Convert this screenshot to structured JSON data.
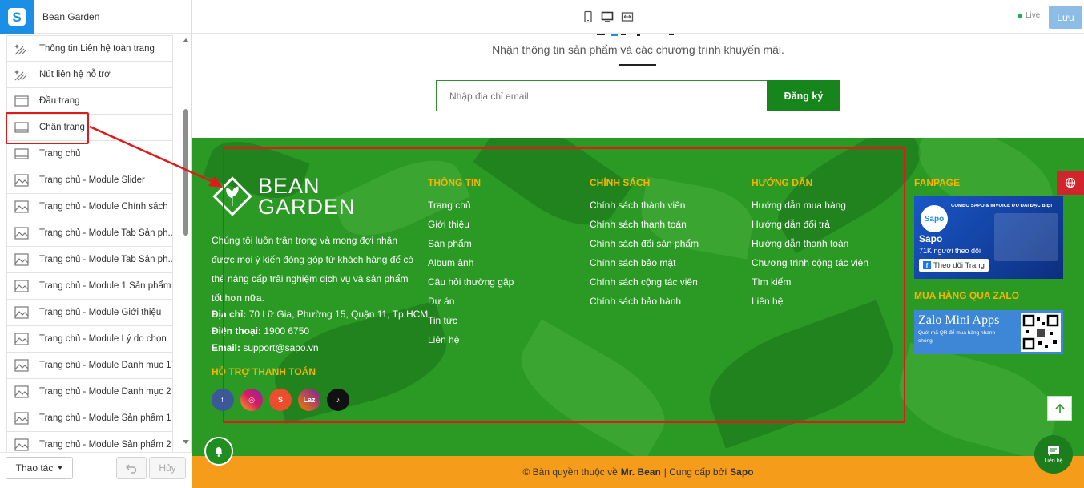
{
  "app": {
    "store_name": "Bean Garden"
  },
  "sections": [
    "Thông tin Liên hệ toàn trang",
    "Nút liên hệ hỗ trợ",
    "Đầu trang",
    "Chân trang",
    "Trang chủ",
    "Trang chủ - Module Slider",
    "Trang chủ - Module Chính sách",
    "Trang chủ - Module Tab Sản ph...",
    "Trang chủ - Module Tab Sản ph...",
    "Trang chủ - Module 1 Sản phẩm",
    "Trang chủ - Module Giới thiệu",
    "Trang chủ - Module Lý do chọn",
    "Trang chủ - Module Danh mục 1",
    "Trang chủ - Module Danh mục 2",
    "Trang chủ - Module Sản phẩm 1",
    "Trang chủ - Module Sản phẩm 2"
  ],
  "left_footer": {
    "actions_label": "Thao tác",
    "cancel_label": "Hủy"
  },
  "topbar": {
    "live_label": "Live",
    "save_label": "Lưu"
  },
  "newsletter": {
    "subtitle": "Nhận thông tin sản phẩm và các chương trình khuyến mãi.",
    "email_placeholder": "Nhập địa chỉ email",
    "submit_label": "Đăng ký"
  },
  "footer": {
    "brand_line1": "BEAN",
    "brand_line2": "GARDEN",
    "about": "Chúng tôi luôn trân trọng và mong đợi nhận được mọi ý kiến đóng góp từ khách hàng để có thể nâng cấp trải nghiệm dịch vụ và sản phẩm tốt hơn nữa.",
    "address_label": "Địa chỉ:",
    "address": "70 Lữ Gia, Phường 15, Quận 11, Tp.HCM",
    "phone_label": "Điện thoại:",
    "phone": "1900 6750",
    "email_label": "Email:",
    "email": "support@sapo.vn",
    "payment_title": "HỖ TRỢ THANH TOÁN",
    "info_col": {
      "title": "THÔNG TIN",
      "links": [
        "Trang chủ",
        "Giới thiệu",
        "Sản phẩm",
        "Album ảnh",
        "Câu hỏi thường gặp",
        "Dự án",
        "Tin tức",
        "Liên hệ"
      ]
    },
    "policy_col": {
      "title": "CHÍNH SÁCH",
      "links": [
        "Chính sách thành viên",
        "Chính sách thanh toán",
        "Chính sách đổi sản phẩm",
        "Chính sách bảo mật",
        "Chính sách cộng tác viên",
        "Chính sách bảo hành"
      ]
    },
    "guide_col": {
      "title": "HƯỚNG DẪN",
      "links": [
        "Hướng dẫn mua hàng",
        "Hướng dẫn đổi trả",
        "Hướng dẫn thanh toán",
        "Chương trình cộng tác viên",
        "Tìm kiếm",
        "Liên hệ"
      ]
    },
    "fanpage": {
      "title": "FANPAGE",
      "banner_text": "COMBO SAPO & INVOICE ƯU ĐÃI ĐẶC BIỆT",
      "page_name": "Sapo",
      "followers": "71K người theo dõi",
      "follow_label": "Theo dõi Trang"
    },
    "zalo": {
      "title": "MUA HÀNG QUA ZALO",
      "banner_title": "Zalo Mini Apps",
      "banner_sub": "Quét mã QR để mua hàng nhanh chóng"
    },
    "copyright_prefix": "© Bản quyền thuộc về",
    "copyright_owner": "Mr. Bean",
    "copyright_mid": "| Cung cấp bởi",
    "copyright_provider": "Sapo"
  },
  "contact_label": "Liên hệ",
  "colors": {
    "primary_green": "#16851c",
    "footer_green": "#2a9a25",
    "accent_orange": "#f59d1b",
    "title_yellow": "#f5b400",
    "annotation_red": "#e0191a"
  }
}
